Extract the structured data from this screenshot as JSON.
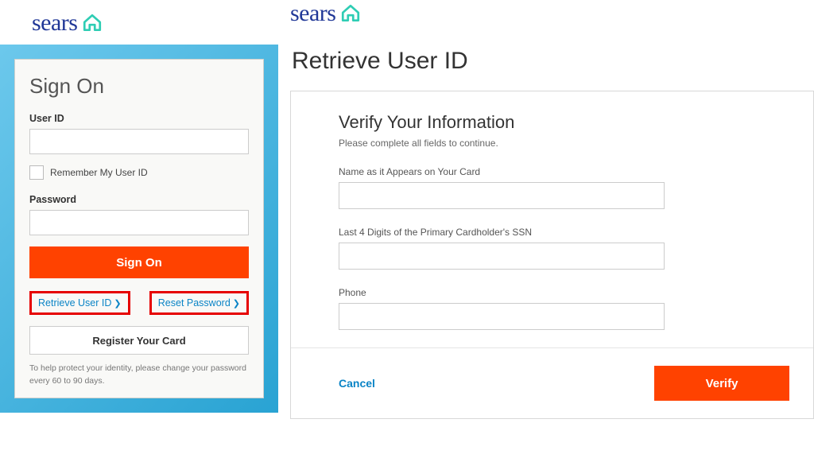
{
  "brand": {
    "name": "sears"
  },
  "signon": {
    "title": "Sign On",
    "user_label": "User ID",
    "remember_label": "Remember My User ID",
    "password_label": "Password",
    "submit_label": "Sign On",
    "retrieve_link": "Retrieve User ID",
    "reset_link": "Reset Password",
    "register_label": "Register Your Card",
    "help_text": "To help protect your identity, please change your password every 60 to 90 days."
  },
  "retrieve": {
    "heading": "Retrieve User ID",
    "verify_title": "Verify Your Information",
    "verify_sub": "Please complete all fields to continue.",
    "name_label": "Name as it Appears on Your Card",
    "ssn_label": "Last 4 Digits of the Primary Cardholder's SSN",
    "phone_label": "Phone",
    "cancel_label": "Cancel",
    "verify_label": "Verify"
  }
}
